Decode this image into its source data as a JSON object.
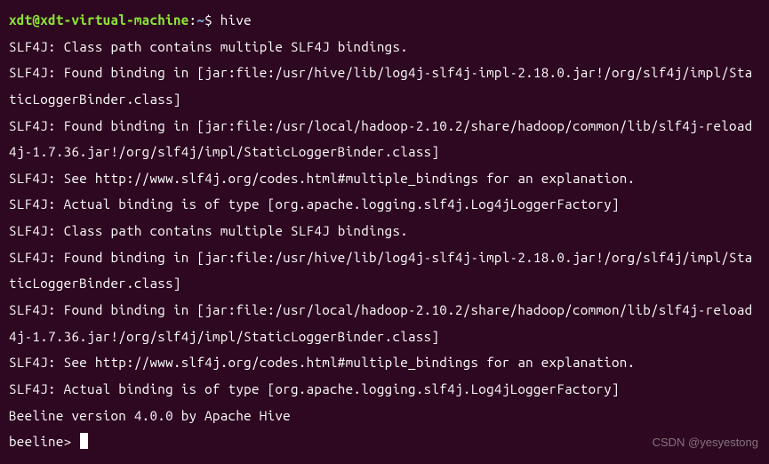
{
  "prompt": {
    "user_host": "xdt@xdt-virtual-machine",
    "separator": ":",
    "path": "~",
    "symbol": "$",
    "command": "hive"
  },
  "output": [
    "SLF4J: Class path contains multiple SLF4J bindings.",
    "SLF4J: Found binding in [jar:file:/usr/hive/lib/log4j-slf4j-impl-2.18.0.jar!/org/slf4j/impl/StaticLoggerBinder.class]",
    "SLF4J: Found binding in [jar:file:/usr/local/hadoop-2.10.2/share/hadoop/common/lib/slf4j-reload4j-1.7.36.jar!/org/slf4j/impl/StaticLoggerBinder.class]",
    "SLF4J: See http://www.slf4j.org/codes.html#multiple_bindings for an explanation.",
    "SLF4J: Actual binding is of type [org.apache.logging.slf4j.Log4jLoggerFactory]",
    "SLF4J: Class path contains multiple SLF4J bindings.",
    "SLF4J: Found binding in [jar:file:/usr/hive/lib/log4j-slf4j-impl-2.18.0.jar!/org/slf4j/impl/StaticLoggerBinder.class]",
    "SLF4J: Found binding in [jar:file:/usr/local/hadoop-2.10.2/share/hadoop/common/lib/slf4j-reload4j-1.7.36.jar!/org/slf4j/impl/StaticLoggerBinder.class]",
    "SLF4J: See http://www.slf4j.org/codes.html#multiple_bindings for an explanation.",
    "SLF4J: Actual binding is of type [org.apache.logging.slf4j.Log4jLoggerFactory]",
    "Beeline version 4.0.0 by Apache Hive"
  ],
  "beeline": {
    "prompt": "beeline> "
  },
  "watermark": "CSDN @yesyestong"
}
